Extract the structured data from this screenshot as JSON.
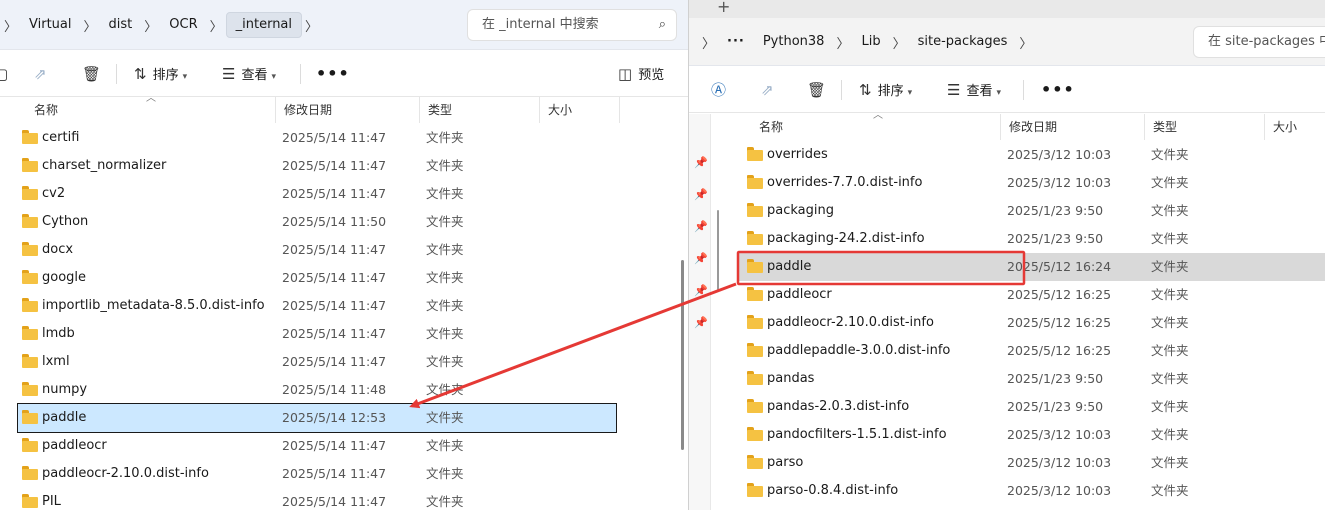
{
  "left": {
    "breadcrumbs": [
      "Virtual",
      "dist",
      "OCR",
      "_internal"
    ],
    "search_placeholder": "在 _internal 中搜索",
    "toolbar": {
      "sort": "排序",
      "view": "查看",
      "more": "•••",
      "preview": "预览"
    },
    "columns": {
      "name": "名称",
      "date": "修改日期",
      "type": "类型",
      "size": "大小"
    },
    "rows": [
      {
        "name": "certifi",
        "date": "2025/5/14 11:47",
        "type": "文件夹"
      },
      {
        "name": "charset_normalizer",
        "date": "2025/5/14 11:47",
        "type": "文件夹"
      },
      {
        "name": "cv2",
        "date": "2025/5/14 11:47",
        "type": "文件夹"
      },
      {
        "name": "Cython",
        "date": "2025/5/14 11:50",
        "type": "文件夹"
      },
      {
        "name": "docx",
        "date": "2025/5/14 11:47",
        "type": "文件夹"
      },
      {
        "name": "google",
        "date": "2025/5/14 11:47",
        "type": "文件夹"
      },
      {
        "name": "importlib_metadata-8.5.0.dist-info",
        "date": "2025/5/14 11:47",
        "type": "文件夹"
      },
      {
        "name": "lmdb",
        "date": "2025/5/14 11:47",
        "type": "文件夹"
      },
      {
        "name": "lxml",
        "date": "2025/5/14 11:47",
        "type": "文件夹"
      },
      {
        "name": "numpy",
        "date": "2025/5/14 11:48",
        "type": "文件夹"
      },
      {
        "name": "paddle",
        "date": "2025/5/14 12:53",
        "type": "文件夹",
        "selected": true
      },
      {
        "name": "paddleocr",
        "date": "2025/5/14 11:47",
        "type": "文件夹"
      },
      {
        "name": "paddleocr-2.10.0.dist-info",
        "date": "2025/5/14 11:47",
        "type": "文件夹"
      },
      {
        "name": "PIL",
        "date": "2025/5/14 11:47",
        "type": "文件夹"
      }
    ]
  },
  "right": {
    "tab_plus": "+",
    "breadcrumbs": [
      "Python38",
      "Lib",
      "site-packages"
    ],
    "search_placeholder": "在 site-packages 中",
    "toolbar": {
      "sort": "排序",
      "view": "查看",
      "more": "•••"
    },
    "columns": {
      "name": "名称",
      "date": "修改日期",
      "type": "类型",
      "size": "大小"
    },
    "rows": [
      {
        "name": "overrides",
        "date": "2025/3/12 10:03",
        "type": "文件夹"
      },
      {
        "name": "overrides-7.7.0.dist-info",
        "date": "2025/3/12 10:03",
        "type": "文件夹"
      },
      {
        "name": "packaging",
        "date": "2025/1/23 9:50",
        "type": "文件夹"
      },
      {
        "name": "packaging-24.2.dist-info",
        "date": "2025/1/23 9:50",
        "type": "文件夹"
      },
      {
        "name": "paddle",
        "date": "2025/5/12 16:24",
        "type": "文件夹",
        "selected": true
      },
      {
        "name": "paddleocr",
        "date": "2025/5/12 16:25",
        "type": "文件夹"
      },
      {
        "name": "paddleocr-2.10.0.dist-info",
        "date": "2025/5/12 16:25",
        "type": "文件夹"
      },
      {
        "name": "paddlepaddle-3.0.0.dist-info",
        "date": "2025/5/12 16:25",
        "type": "文件夹"
      },
      {
        "name": "pandas",
        "date": "2025/1/23 9:50",
        "type": "文件夹"
      },
      {
        "name": "pandas-2.0.3.dist-info",
        "date": "2025/1/23 9:50",
        "type": "文件夹"
      },
      {
        "name": "pandocfilters-1.5.1.dist-info",
        "date": "2025/3/12 10:03",
        "type": "文件夹"
      },
      {
        "name": "parso",
        "date": "2025/3/12 10:03",
        "type": "文件夹"
      },
      {
        "name": "parso-0.8.4.dist-info",
        "date": "2025/3/12 10:03",
        "type": "文件夹"
      }
    ]
  },
  "colors": {
    "annotation": "#e53935",
    "selection": "#cce8ff",
    "folder": "#f5c242"
  },
  "icons": [
    "search-icon",
    "folder-icon",
    "delete-icon",
    "share-icon",
    "copy-path-icon",
    "sort-icon",
    "view-icon",
    "preview-icon",
    "pin-icon",
    "chevron-right-icon"
  ]
}
